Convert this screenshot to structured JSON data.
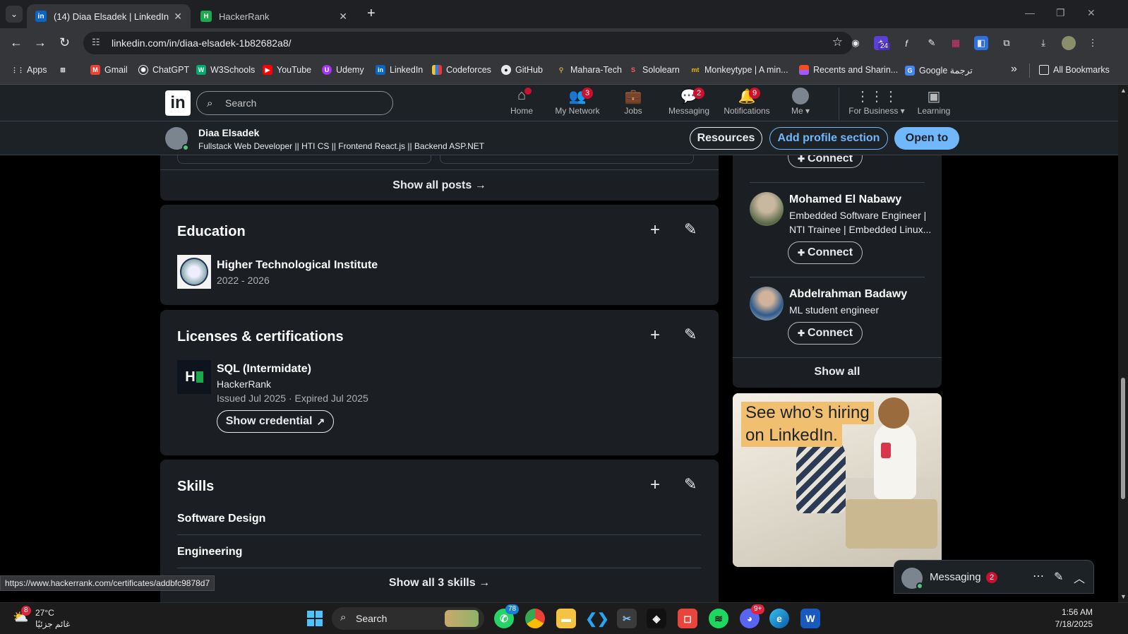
{
  "browser": {
    "tabs": [
      {
        "title": "(14) Diaa Elsadek | LinkedIn",
        "favicon": "in"
      },
      {
        "title": "HackerRank",
        "favicon": "H"
      }
    ],
    "url": "linkedin.com/in/diaa-elsadek-1b82682a8/",
    "extension_badge": "24",
    "bookmarks": [
      {
        "label": "Apps"
      },
      {
        "label": ""
      },
      {
        "label": "Gmail"
      },
      {
        "label": "ChatGPT"
      },
      {
        "label": "W3Schools"
      },
      {
        "label": "YouTube"
      },
      {
        "label": "Udemy"
      },
      {
        "label": "LinkedIn"
      },
      {
        "label": "Codeforces"
      },
      {
        "label": "GitHub"
      },
      {
        "label": "Mahara-Tech"
      },
      {
        "label": "Sololearn"
      },
      {
        "label": "Monkeytype | A min..."
      },
      {
        "label": "Recents and Sharin..."
      },
      {
        "label": "Google ترجمة"
      }
    ],
    "more_bookmarks": "»",
    "all_bookmarks": "All Bookmarks",
    "status_link": "https://www.hackerrank.com/certificates/addbfc9878d7"
  },
  "linkedin": {
    "logo": "in",
    "search_placeholder": "Search",
    "nav": [
      {
        "label": "Home",
        "badge": ""
      },
      {
        "label": "My Network",
        "badge": "3"
      },
      {
        "label": "Jobs",
        "badge": ""
      },
      {
        "label": "Messaging",
        "badge": "2"
      },
      {
        "label": "Notifications",
        "badge": "9"
      },
      {
        "label": "Me",
        "badge": ""
      },
      {
        "label": "For Business",
        "badge": ""
      },
      {
        "label": "Learning",
        "badge": ""
      }
    ],
    "profile_bar": {
      "name": "Diaa Elsadek",
      "headline": "Fullstack Web Developer || HTI CS || Frontend React.js || Backend ASP.NET",
      "resources": "Resources",
      "add_section": "Add profile section",
      "open_to": "Open to"
    },
    "posts": {
      "show_all": "Show all posts →"
    },
    "education": {
      "title": "Education",
      "school": "Higher Technological Institute",
      "years": "2022 - 2026"
    },
    "licenses": {
      "title": "Licenses & certifications",
      "name": "SQL (Intermidate)",
      "issuer": "HackerRank",
      "dates": "Issued Jul 2025 · Expired Jul 2025",
      "credential": "Show credential"
    },
    "skills": {
      "title": "Skills",
      "items": [
        "Software Design",
        "Engineering"
      ],
      "show_all": "Show all 3 skills →"
    },
    "people": [
      {
        "name": "Mohamed El Nabawy",
        "headline_1": "Embedded Software Engineer |",
        "headline_2": "NTI Trainee | Embedded Linux...",
        "connect": "Connect"
      },
      {
        "name": "Abdelrahman Badawy",
        "headline_1": "ML student engineer",
        "headline_2": "",
        "connect": "Connect"
      }
    ],
    "top_connect": "Connect",
    "people_show_all": "Show all",
    "ad": {
      "line1": "See who’s hiring",
      "line2": "on LinkedIn."
    },
    "messaging": {
      "label": "Messaging",
      "badge": "2"
    }
  },
  "taskbar": {
    "weather_temp": "27°C",
    "weather_desc": "غائم جزئيًا",
    "weather_badge": "8",
    "search": "Search",
    "whatsapp_badge": "78",
    "discord_badge": "9+",
    "time": "1:56 AM",
    "date": "7/18/2025"
  },
  "colors": {
    "linkedin_blue": "#71b7fb",
    "badge_red": "#cb112d",
    "card_bg": "#1b1f23"
  }
}
